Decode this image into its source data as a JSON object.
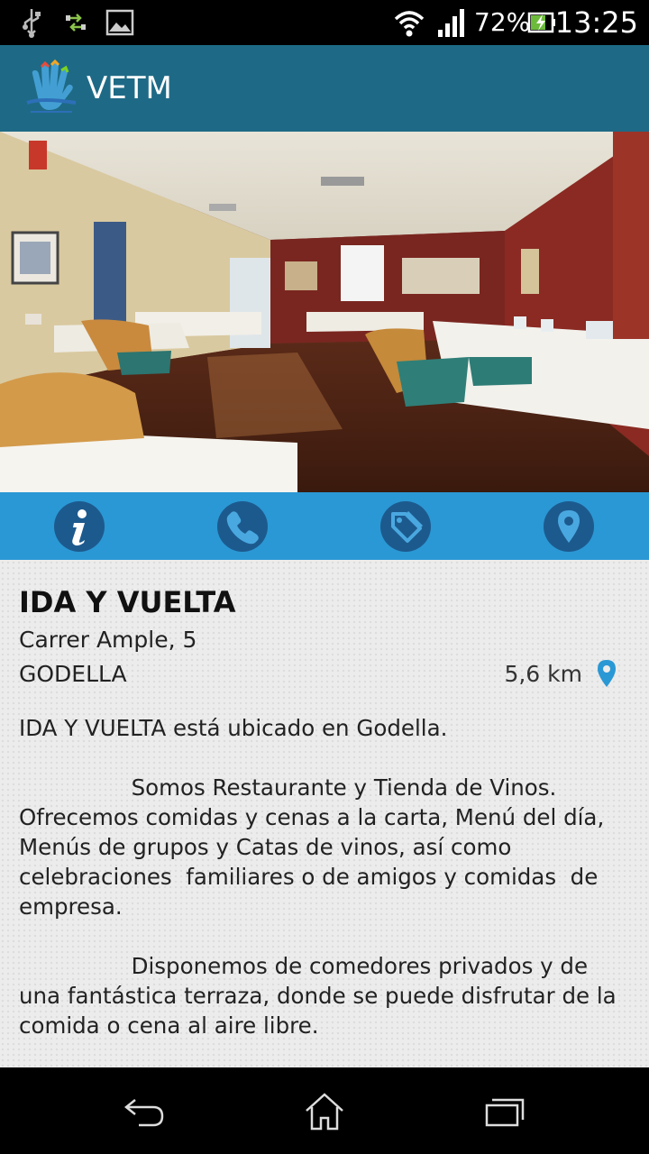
{
  "status_bar": {
    "battery_percent": "72%",
    "time": "13:25",
    "icons": [
      "usb-icon",
      "data-sync-icon",
      "image-icon",
      "wifi-icon",
      "signal-icon",
      "battery-charging-icon"
    ]
  },
  "app_bar": {
    "title": "VETM",
    "logo_icon": "app-logo-hand-icon"
  },
  "gallery": {
    "pages": 3,
    "current_page": 2
  },
  "tabs": [
    {
      "id": "info",
      "icon": "info-icon"
    },
    {
      "id": "phone",
      "icon": "phone-icon"
    },
    {
      "id": "offers",
      "icon": "tag-icon"
    },
    {
      "id": "map",
      "icon": "map-pin-icon"
    }
  ],
  "place": {
    "name": "IDA Y VUELTA",
    "street": "Carrer Ample, 5",
    "town": "GODELLA",
    "distance": "5,6 km",
    "description": "IDA Y VUELTA está ubicado en Godella.\n\n                Somos Restaurante y Tienda de Vinos. Ofrecemos comidas y cenas a la carta, Menú del día, Menús de grupos y Catas de vinos, así como celebraciones  familiares o de amigos y comidas  de empresa.\n\n                Disponemos de comedores privados y de una fantástica terraza, donde se puede disfrutar de la comida o cena al aire libre."
  },
  "colors": {
    "app_bar": "#1e6a86",
    "tab_bar": "#2a98d4",
    "tab_icon_bg": "#1c5a8e",
    "pin": "#2a98d4"
  }
}
